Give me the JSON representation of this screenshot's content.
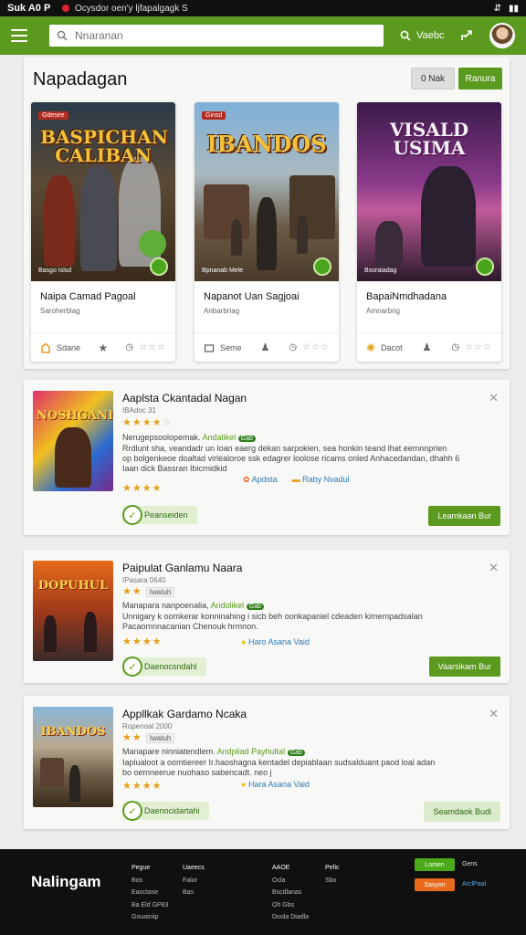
{
  "status_bar": {
    "left": "Suk A0 P",
    "tab_title": "Ocysdor oen'y ljfapalgagk S",
    "right_a": "⇵",
    "right_b": "▮▮"
  },
  "app_bar": {
    "search_placeholder": "Nnaranan",
    "btn1_label": "Vaebc",
    "brand_color": "#5b9a1e"
  },
  "main": {
    "title": "Napadagan",
    "btn_grey": "0 Nak",
    "btn_green": "Ranura",
    "cards": [
      {
        "art_title": "BASPICHAN CALIBAN",
        "art_tag": "Gdesee",
        "art_foot": "Basgo Islsd",
        "name": "Naipa Camad Pagoal",
        "sub": "Saroherblag",
        "foot_label": "Sdane"
      },
      {
        "art_title": "IBANDOS",
        "art_tag": "Ginsd",
        "art_foot": "Bpnanab Mele",
        "name": "Napanot Uan Sagjoai",
        "sub": "Anbarbriag",
        "foot_label": "Seme"
      },
      {
        "art_title": "VISALD USIMA",
        "art_tag": "",
        "art_foot": "Bsoraiadag",
        "name": "BapaiNmdhadana",
        "sub": "Amnarbrig",
        "foot_label": "Dacot"
      }
    ]
  },
  "list": [
    {
      "thumb_title": "NOSHGANICA",
      "title": "Aaplsta Ckantadal Nagan",
      "meta": "IBAdoc 31",
      "desc1_a": "Nerugepsoolopemak.",
      "desc1_b": "Andalikel",
      "desc1_pill": "Gab",
      "desc2": "Rrdlunt sha, veandadr un loan eaerg dekan sarpokien, sea honkin teand lhat eemnnprien",
      "desc3": "op bolgenkeoe doaltad virlealoroe ssk edagrer loolose ricams onled Anhacedandan, dhahh 6",
      "desc4": "Iaan dick Bassran Ibicrnidkid",
      "link1": "Apdsta",
      "link2": "Raby Nvadul",
      "badge": "Peanseiden",
      "action": "Leamkaan Bur"
    },
    {
      "thumb_title": "DOPUHUL",
      "title": "Paipulat Ganlamu Naara",
      "meta": "IPasara 0640",
      "tag": "Iwatuh",
      "desc1_a": "Manapara nanpoenalia,",
      "desc1_b": "Andolikel",
      "desc1_pill": "Gab",
      "desc2": "Unnigary k oomkerar konninahing i sicb beh oonkapaniel cdeaden kimempadsalan",
      "desc3": "Pacaomnnacanian Chenouk hrmnon.",
      "link1": "Haro Asana Vaid",
      "badge": "Daenocsndahl",
      "action": "Vaarsikam Bur"
    },
    {
      "thumb_title": "IBANDOS",
      "title": "Appllkak Gardamo Ncaka",
      "meta": "Ropenoal 2000",
      "tag": "Iwatuh",
      "desc1_a": "Manapare ninniatendlem.",
      "desc1_b": "Andpliad Payhultal",
      "desc1_pill": "Gab",
      "desc2": "Iaplualoot a oomtiereer Ir.haoshagna kentadel depiablaan sudsalduant paod loal adan",
      "desc3": "bo oemneerue nuohaso sabencadt. neo j",
      "link1": "Hara Asana Vaid",
      "badge": "Daenocidartahi",
      "action": "Seamdaok Budi"
    }
  ],
  "footer": {
    "brand": "Nalingam",
    "col1": [
      "Pegue",
      "Bos",
      "Eaoctase",
      "Ba Eld GP83",
      "Gouainiip"
    ],
    "col2": [
      "Uaeecs",
      "Falor",
      "Bas"
    ],
    "col3": [
      "AAOE",
      "Ocla",
      "Bscdlanas",
      "Oh Gbs",
      "Doola Diadla"
    ],
    "col4": [
      "Pefic",
      "Sbo"
    ],
    "btn_green": "Lomen",
    "btn_orange": "Sasyon",
    "link1": "Gens",
    "link2": "ArclPaal"
  }
}
